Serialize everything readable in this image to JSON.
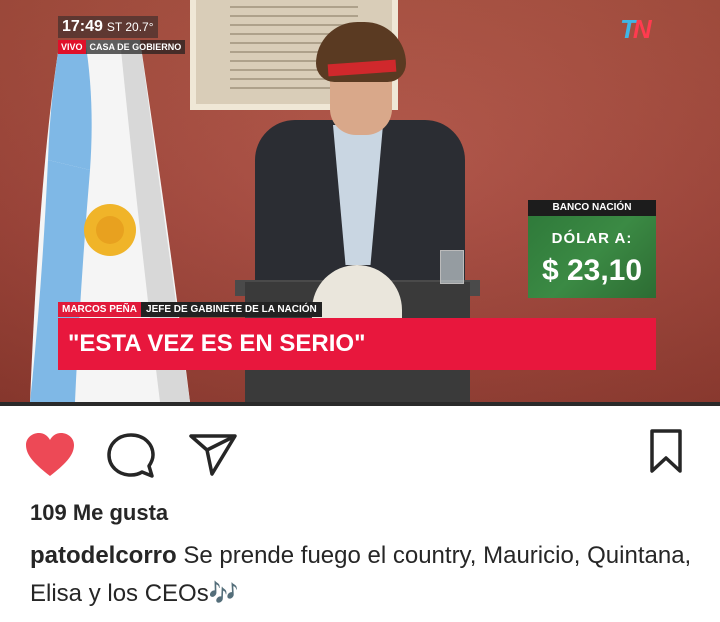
{
  "broadcast": {
    "time": "17:49",
    "temperature": "ST 20.7°",
    "live_label": "VIVO",
    "location": "CASA DE GOBIERNO",
    "channel_logo_a": "T",
    "channel_logo_b": "N",
    "bank_label": "BANCO NACIÓN",
    "dollar_title": "DÓLAR A:",
    "dollar_value": "$ 23,10",
    "speaker_name": "MARCOS PEÑA",
    "speaker_role": "JEFE DE GABINETE DE LA NACIÓN",
    "headline": "\"ESTA VEZ ES EN SERIO\""
  },
  "actions": {
    "like_icon": "heart-icon",
    "comment_icon": "comment-icon",
    "share_icon": "send-icon",
    "save_icon": "bookmark-icon",
    "like_color": "#ed4956"
  },
  "post": {
    "likes": "109 Me gusta",
    "username": "patodelcorro",
    "caption": " Se prende fuego el country, Mauricio, Quintana, Elisa  y los CEOs",
    "caption_emoji": "🎶"
  }
}
